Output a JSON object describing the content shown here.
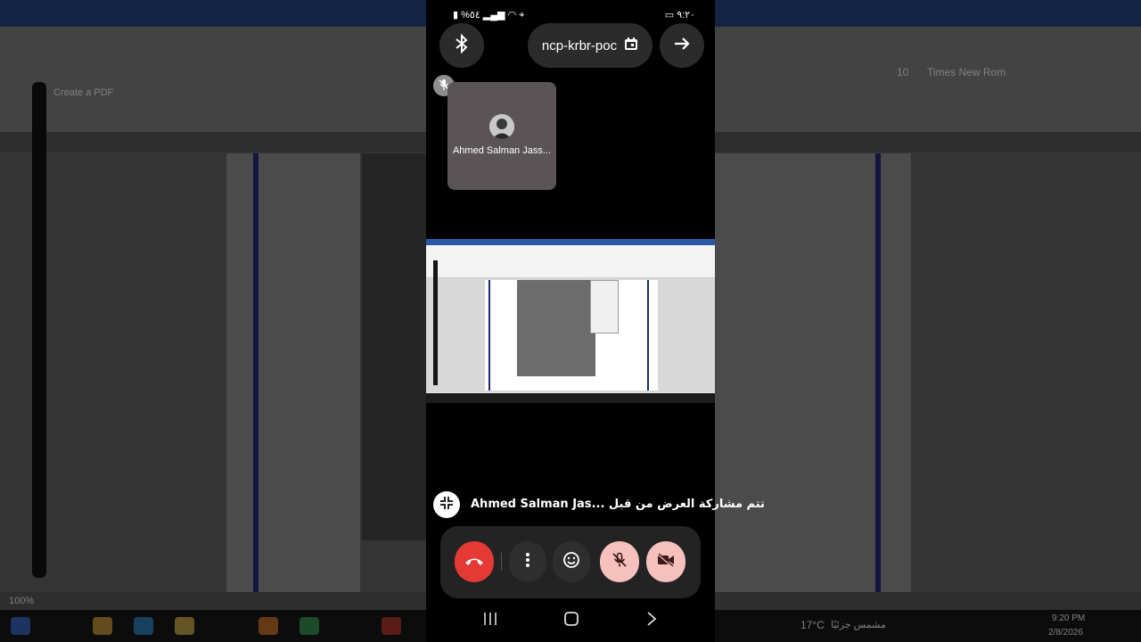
{
  "background": {
    "acrobat_label": "Create a PDF",
    "zoom": "100%",
    "weather_temp": "17°C",
    "weather_label": "مشمس جزئيًا",
    "clock_time": "9:20 PM",
    "clock_date": "2/8/2026",
    "font_name": "Times New Rom",
    "font_size": "10"
  },
  "status_bar": {
    "time": "٩:٢٠",
    "battery": "%٥٤"
  },
  "top_bar": {
    "meeting_code": "ncp-krbr-poc"
  },
  "participant": {
    "name": "Ahmed Salman Jass..."
  },
  "share_banner": {
    "text": "تتم مشاركة العرض من قبل ...Ahmed Salman Jas"
  },
  "colors": {
    "end_call": "#e53935",
    "muted_bg": "#f6c0bd",
    "control_bg": "#2e2e2e",
    "panel_bg": "#232323"
  },
  "icons": {
    "bluetooth": "bluetooth-icon",
    "calendar": "calendar-icon",
    "arrow": "arrow-right-icon",
    "exit_fullscreen": "exit-fullscreen-icon",
    "end_call": "phone-hangup-icon",
    "more": "more-vert-icon",
    "emoji": "emoji-icon",
    "mic_off": "mic-off-icon",
    "camera_off": "camera-off-icon"
  }
}
